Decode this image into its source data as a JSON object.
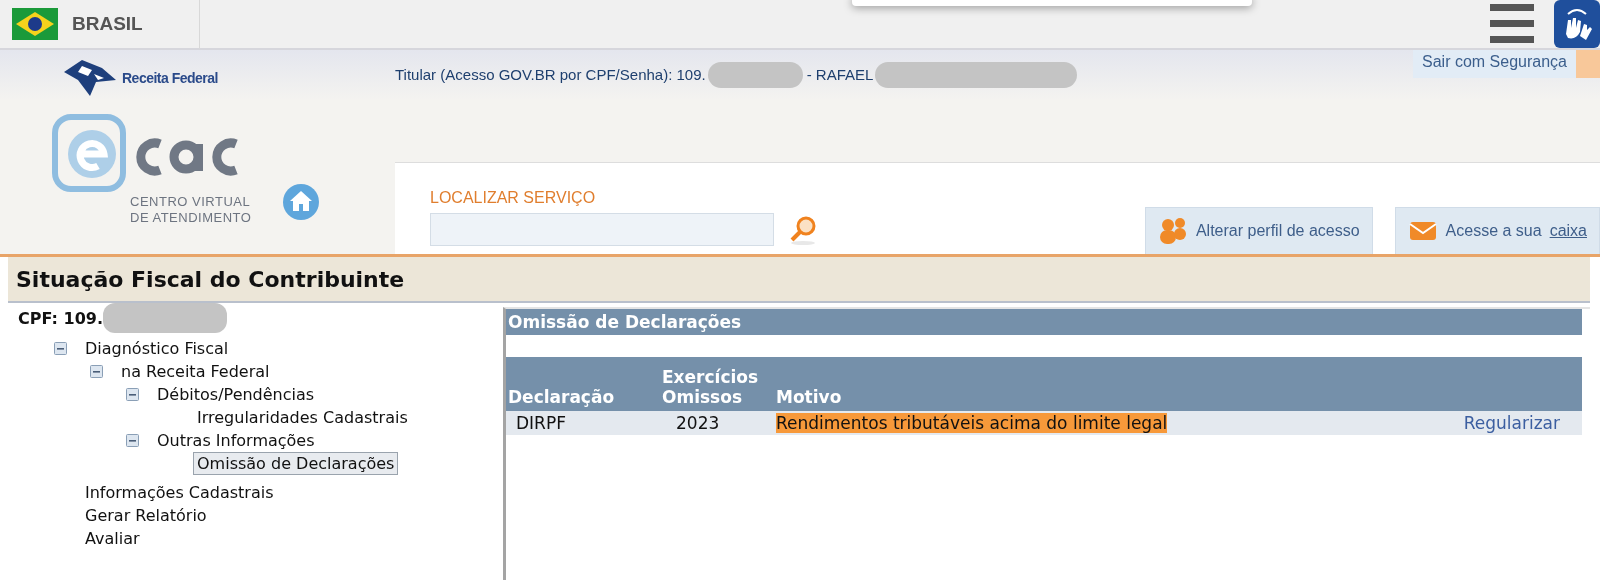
{
  "top_bar": {
    "country": "BRASIL"
  },
  "header": {
    "brand": "Receita Federal",
    "user_label": "Titular (Acesso GOV.BR por CPF/Senha): 109.",
    "user_name_prefix": "- RAFAEL",
    "logout": "Sair com Segurança",
    "logo_subtitle_1": "CENTRO VIRTUAL",
    "logo_subtitle_2": "DE ATENDIMENTO",
    "search": {
      "label": "LOCALIZAR SERVIÇO"
    },
    "actions": [
      {
        "label": "Alterar perfil de acesso"
      },
      {
        "label": "Acesse a sua ",
        "link": "caixa"
      }
    ]
  },
  "page_title": "Situação Fiscal do Contribuinte",
  "sidebar": {
    "cpf": "CPF: 109.",
    "tree": [
      {
        "label": "Diagnóstico Fiscal",
        "expanded": true,
        "selected": false,
        "children": [
          {
            "label": "na Receita Federal",
            "expanded": true,
            "selected": false,
            "children": [
              {
                "label": "Débitos/Pendências",
                "expanded": true,
                "selected": false,
                "children": [
                  {
                    "label": "Irregularidades Cadastrais",
                    "selected": false
                  }
                ]
              },
              {
                "label": "Outras Informações",
                "expanded": true,
                "selected": false,
                "children": [
                  {
                    "label": "Omissão de Declarações",
                    "selected": true
                  }
                ]
              }
            ]
          }
        ]
      },
      {
        "label": "Informações Cadastrais",
        "selected": false
      },
      {
        "label": "Gerar Relatório",
        "selected": false
      },
      {
        "label": "Avaliar",
        "selected": false
      }
    ]
  },
  "panel": {
    "title": "Omissão de Declarações",
    "table": {
      "columns": [
        "Declaração",
        "Exercícios Omissos",
        "Motivo"
      ],
      "rows": [
        {
          "declaracao": "DIRPF",
          "exercicio": "2023",
          "motivo": "Rendimentos tributáveis acima do limite legal",
          "motivo_highlighted": true,
          "action": "Regularizar"
        }
      ]
    }
  }
}
